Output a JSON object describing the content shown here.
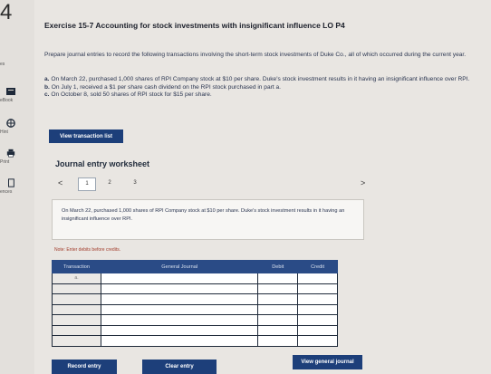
{
  "page_number": "4",
  "rail": {
    "items": [
      {
        "label": "es",
        "icon": "none"
      },
      {
        "label": "eBook",
        "icon": "book-icon"
      },
      {
        "label": "Hint",
        "icon": "hint-icon"
      },
      {
        "label": "Print",
        "icon": "print-icon"
      },
      {
        "label": "ences",
        "icon": "references-icon"
      }
    ]
  },
  "exercise": {
    "title": "Exercise 15-7 Accounting for stock investments with insignificant influence LO P4",
    "intro": "Prepare journal entries to record the following transactions involving the short-term stock investments of Duke Co., all of which occurred during the current year.",
    "items": [
      {
        "letter": "a.",
        "text": "On March 22, purchased 1,000 shares of RPI Company stock at $10 per share. Duke's stock investment results in it having an insignificant influence over RPI."
      },
      {
        "letter": "b.",
        "text": "On July 1, received a $1 per share cash dividend on the RPI stock purchased in part a."
      },
      {
        "letter": "c.",
        "text": "On October 8, sold 50 shares of RPI stock for $15 per share."
      }
    ]
  },
  "buttons": {
    "view_transaction_list": "View transaction list",
    "record_entry": "Record entry",
    "clear_entry": "Clear entry",
    "view_general_journal": "View general journal"
  },
  "worksheet": {
    "title": "Journal entry worksheet",
    "prev": "<",
    "next": ">",
    "tabs": [
      "1",
      "2",
      "3"
    ],
    "active_tab": "1",
    "description": "On March 22, purchased 1,000 shares of RPI Company stock at $10 per share. Duke's stock investment results in it having an insignificant influence over RPI.",
    "note": "Note: Enter debits before credits."
  },
  "journal_table": {
    "headers": [
      "Transaction",
      "General Journal",
      "Debit",
      "Credit"
    ],
    "first_row_label": "a."
  },
  "colors": {
    "button": "#1d3f7a",
    "table_header": "#2a4b86",
    "note": "#a23c2b"
  }
}
